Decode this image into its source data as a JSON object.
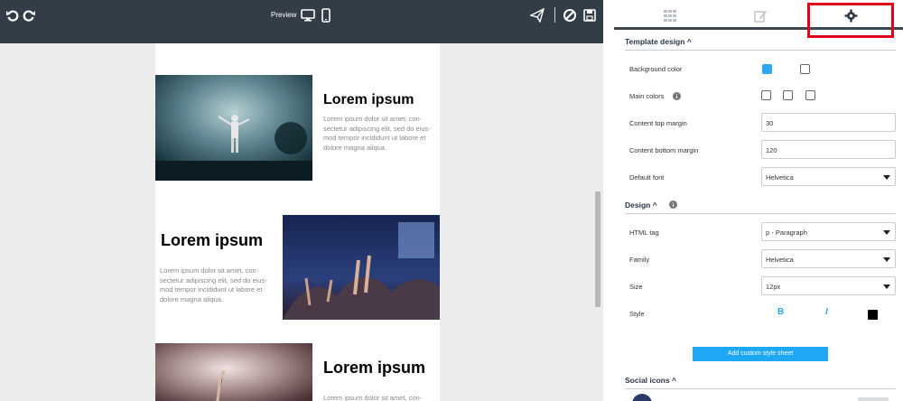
{
  "topbar": {
    "undo_icon": "undo-icon",
    "redo_icon": "redo-icon",
    "preview_label": "Preview",
    "desktop_icon": "desktop-icon",
    "mobile_icon": "mobile-icon",
    "send_icon": "paper-plane-icon",
    "disable_icon": "ban-icon",
    "save_icon": "floppy-disk-icon"
  },
  "canvas": {
    "blocks": [
      {
        "title": "Lorem ipsum",
        "text": [
          "Lorem ipsum dolor sit amet, con-",
          "sectetur adipiscing elit, sed do eius-",
          "mod tempor incididunt ut labore et",
          "dolore magna aliqua."
        ]
      },
      {
        "title": "Lorem ipsum",
        "text": [
          "Lorem ipsum dolor sit amet, con-",
          "sectetur adipiscing elit, sed do eius-",
          "mod tempor incididunt ut labore et",
          "dolore magna aliqua."
        ]
      },
      {
        "title": "Lorem ipsum",
        "text": [
          "Lorem ipsum dolor sit amet, con-"
        ]
      }
    ]
  },
  "panel": {
    "tabs": [
      {
        "icon": "grid-icon"
      },
      {
        "icon": "edit-icon"
      },
      {
        "icon": "gear-icon",
        "active": true
      }
    ],
    "template_design": {
      "heading": "Template design ^",
      "background_color_label": "Background color",
      "main_colors_label": "Main colors",
      "content_top_margin_label": "Content top margin",
      "content_top_margin_value": "30",
      "content_bottom_margin_label": "Content bottom margin",
      "content_bottom_margin_value": "120",
      "default_font_label": "Default font",
      "default_font_value": "Helvetica"
    },
    "design": {
      "heading": "Design ^",
      "html_tag_label": "HTML tag",
      "html_tag_value": "p - Paragraph",
      "family_label": "Family",
      "family_value": "Helvetica",
      "size_label": "Size",
      "size_value": "12px",
      "style_label": "Style",
      "bold_label": "B",
      "italic_label": "I",
      "color_swatch": "#000000"
    },
    "add_style_button": "Add custom style sheet",
    "social_icons_heading": "Social icons ^"
  },
  "colors": {
    "topbar": "#333d47",
    "accent": "#1ea7f2",
    "highlight": "#e0001b"
  }
}
